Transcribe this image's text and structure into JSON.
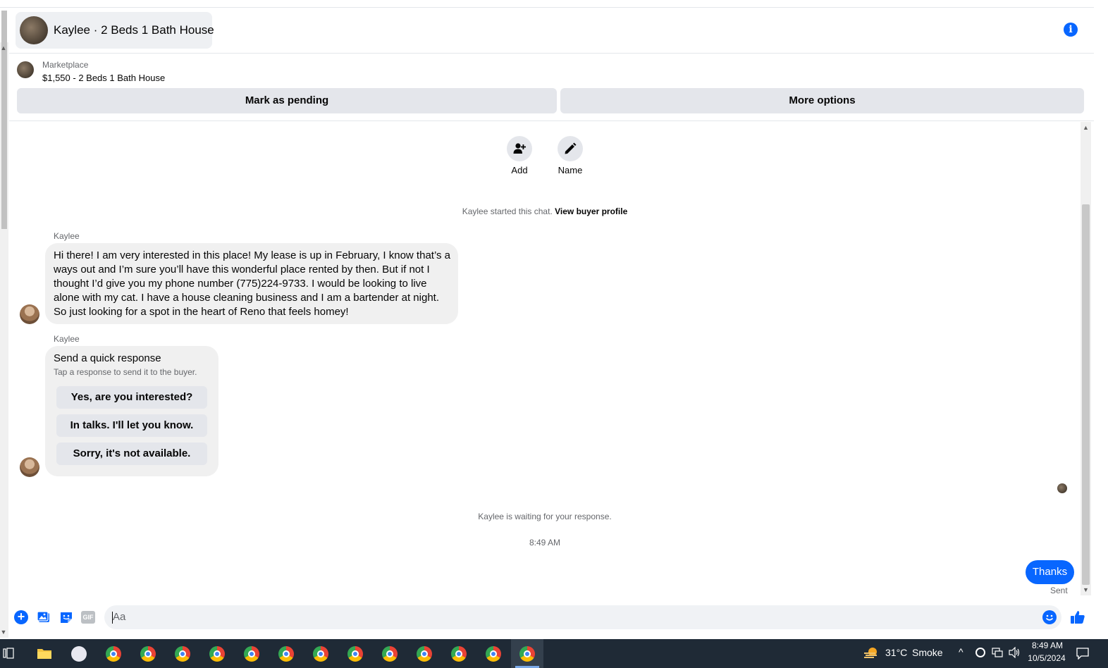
{
  "header": {
    "title": "Kaylee · 2 Beds 1 Bath House"
  },
  "listing": {
    "label": "Marketplace",
    "title": "$1,550 - 2 Beds 1 Bath House"
  },
  "actions": {
    "mark_pending": "Mark as pending",
    "more_options": "More options",
    "add_label": "Add",
    "name_label": "Name"
  },
  "chat": {
    "started_text": "Kaylee started this chat.",
    "view_profile": "View buyer profile",
    "sender_name": "Kaylee",
    "message": "Hi there! I am very interested in this place! My lease is up in February, I know that’s a ways out and I’m sure you’ll have this wonderful place rented by then. But if not I thought I’d give you my phone number (775)224-9733. I would be looking to live alone with my cat. I have a house cleaning business and I am a bartender at night. So just looking for a spot in the heart of Reno that feels homey!",
    "quick_response": {
      "title": "Send a quick response",
      "subtitle": "Tap a response to send it to the buyer.",
      "options": [
        "Yes, are you interested?",
        "In talks. I'll let you know.",
        "Sorry, it's not available."
      ]
    },
    "waiting_text": "Kaylee is waiting for your response.",
    "timestamp": "8:49 AM",
    "sent_message": "Thanks",
    "sent_status": "Sent"
  },
  "composer": {
    "placeholder": "Aa",
    "gif_label": "GIF"
  },
  "taskbar": {
    "weather_temp": "31°C",
    "weather_text": "Smoke",
    "time": "8:49 AM",
    "date": "10/5/2024"
  },
  "colors": {
    "accent": "#0866ff",
    "bubble_gray": "#f0f0f0",
    "button_gray": "#e4e6eb",
    "taskbar": "#1f2a36"
  }
}
